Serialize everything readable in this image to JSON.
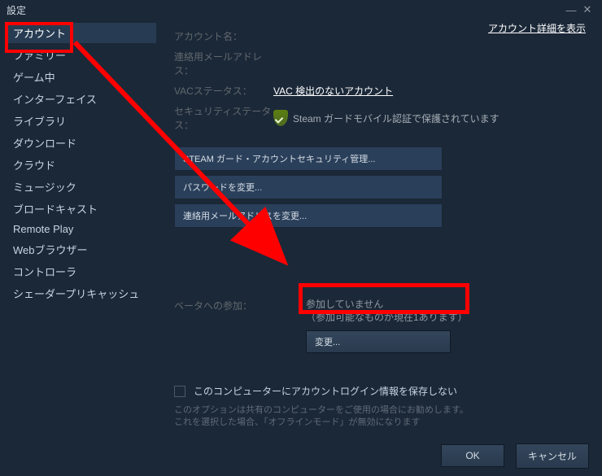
{
  "window": {
    "title": "設定"
  },
  "sidebar": {
    "items": [
      {
        "label": "アカウント",
        "active": true
      },
      {
        "label": "ファミリー"
      },
      {
        "label": "ゲーム中"
      },
      {
        "label": "インターフェイス"
      },
      {
        "label": "ライブラリ"
      },
      {
        "label": "ダウンロード"
      },
      {
        "label": "クラウド"
      },
      {
        "label": "ミュージック"
      },
      {
        "label": "ブロードキャスト"
      },
      {
        "label": "Remote Play"
      },
      {
        "label": "Webブラウザー"
      },
      {
        "label": "コントローラ"
      },
      {
        "label": "シェーダープリキャッシュ"
      }
    ]
  },
  "content": {
    "detail_link": "アカウント詳細を表示",
    "account_name_label": "アカウント名：",
    "email_label": "連絡用メールアドレス：",
    "vac_label": "VACステータス：",
    "vac_value": "VAC 検出のないアカウント",
    "security_label": "セキュリティステータス：",
    "security_value": "Steam ガードモバイル認証で保護されています",
    "btn_manage": "STEAM ガード・アカウントセキュリティ管理...",
    "btn_password": "パスワードを変更...",
    "btn_email": "連絡用メールアドレスを変更...",
    "beta_label": "ベータへの参加：",
    "beta_info1": "参加していません",
    "beta_info2": "（参加可能なものが現在1あります）",
    "change_label": "変更...",
    "checkbox_label": "このコンピューターにアカウントログイン情報を保存しない",
    "hint1": "このオプションは共有のコンピューターをご使用の場合にお勧めします。",
    "hint2": "これを選択した場合、「オフラインモード」が無効になります"
  },
  "footer": {
    "ok": "OK",
    "cancel": "キャンセル"
  }
}
